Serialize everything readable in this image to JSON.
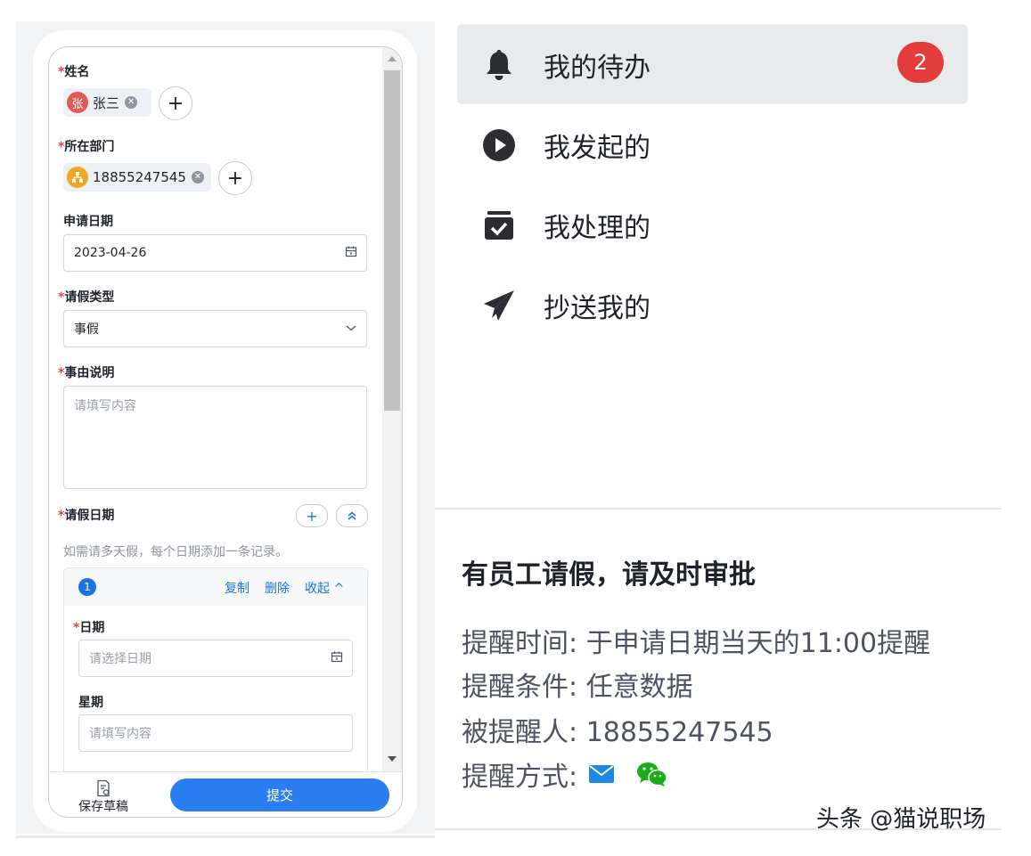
{
  "form": {
    "name": {
      "label": "姓名",
      "chip_avatar": "张",
      "chip_text": "张三"
    },
    "department": {
      "label": "所在部门",
      "chip_text": "18855247545"
    },
    "apply_date": {
      "label": "申请日期",
      "value": "2023-04-26"
    },
    "leave_type": {
      "label": "请假类型",
      "value": "事假"
    },
    "reason": {
      "label": "事由说明",
      "placeholder": "请填写内容"
    },
    "leave_dates": {
      "label": "请假日期",
      "hint": "如需请多天假，每个日期添加一条记录。",
      "record": {
        "index": "1",
        "copy": "复制",
        "delete": "删除",
        "collapse": "收起",
        "date_label": "日期",
        "date_placeholder": "请选择日期",
        "weekday_label": "星期",
        "weekday_placeholder": "请填写内容"
      }
    },
    "required_mark": "*",
    "save_draft": "保存草稿",
    "submit": "提交"
  },
  "menu": [
    {
      "label": "我的待办",
      "icon": "bell-icon",
      "badge": "2",
      "active": true
    },
    {
      "label": "我发起的",
      "icon": "play-circle-icon",
      "active": false
    },
    {
      "label": "我处理的",
      "icon": "checked-archive-icon",
      "active": false
    },
    {
      "label": "抄送我的",
      "icon": "paper-plane-icon",
      "active": false
    }
  ],
  "notice": {
    "title": "有员工请假，请及时审批",
    "time": "提醒时间: 于申请日期当天的11:00提醒",
    "condition": "提醒条件: 任意数据",
    "recipient": "被提醒人: 18855247545",
    "method": "提醒方式:"
  },
  "watermark": "头条 @猫说职场",
  "colors": {
    "accent": "#2b7ef0",
    "badge": "#e23c3c",
    "required": "#e54545",
    "wechat": "#1aad19",
    "mail": "#1e88e5"
  }
}
